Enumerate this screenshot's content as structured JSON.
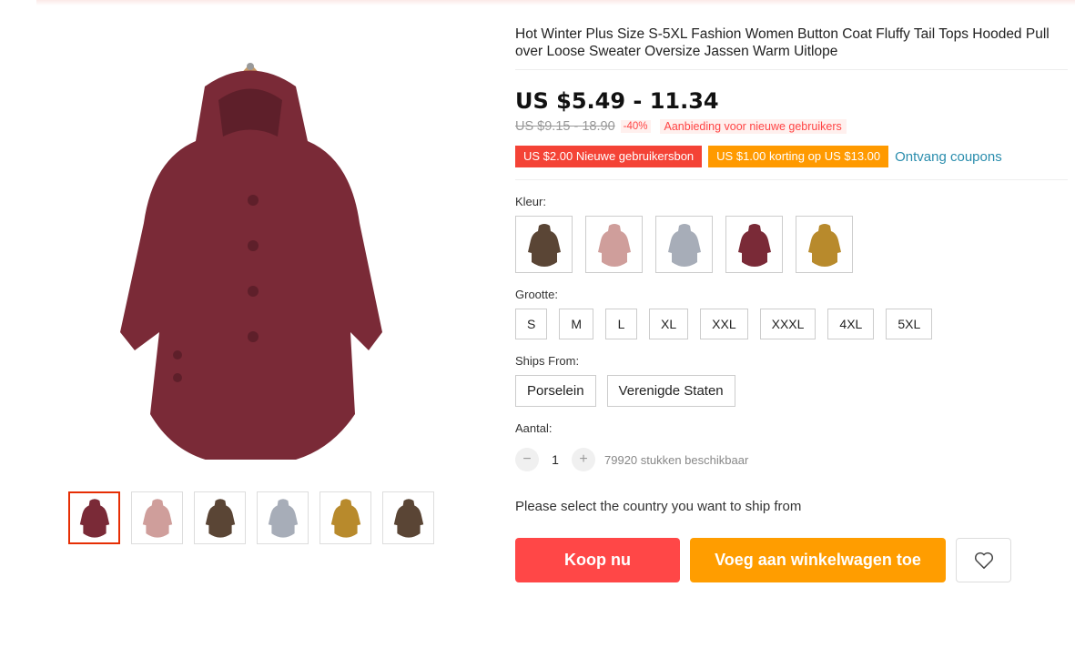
{
  "product": {
    "title": "Hot Winter Plus Size S-5XL Fashion Women Button Coat Fluffy Tail Tops Hooded Pull over Loose Sweater Oversize Jassen Warm Uitlope",
    "price": "US $5.49 - 11.34",
    "original_price": "US $9.15 - 18.90",
    "discount": "-40%",
    "promo_text": "Aanbieding voor nieuwe gebruikers"
  },
  "coupons": {
    "new_user": "US $2.00 Nieuwe gebruikersbon",
    "discount": "US $1.00 korting op US $13.00",
    "get_link": "Ontvang coupons"
  },
  "color": {
    "label": "Kleur:",
    "options": [
      {
        "name": "coffee",
        "hex": "#5a4535"
      },
      {
        "name": "pink",
        "hex": "#cf9e9b"
      },
      {
        "name": "gray",
        "hex": "#a7adb8"
      },
      {
        "name": "wine",
        "hex": "#7a2a37"
      },
      {
        "name": "khaki",
        "hex": "#b88a2c"
      }
    ]
  },
  "size": {
    "label": "Grootte:",
    "options": [
      "S",
      "M",
      "L",
      "XL",
      "XXL",
      "XXXL",
      "4XL",
      "5XL"
    ]
  },
  "ships_from": {
    "label": "Ships From:",
    "options": [
      "Porselein",
      "Verenigde Staten"
    ]
  },
  "quantity": {
    "label": "Aantal:",
    "minus": "−",
    "value": "1",
    "plus": "+",
    "available": "79920 stukken beschikbaar"
  },
  "ship_note": "Please select the country you want to ship from",
  "actions": {
    "buy": "Koop nu",
    "cart": "Voeg aan winkelwagen toe",
    "wishlist_icon": "heart-icon"
  },
  "gallery": {
    "main_color": "#7a2a37",
    "thumbnails": [
      "#7a2a37",
      "#cf9e9b",
      "#5a4535",
      "#a7adb8",
      "#b88a2c",
      "#5a4535"
    ]
  }
}
